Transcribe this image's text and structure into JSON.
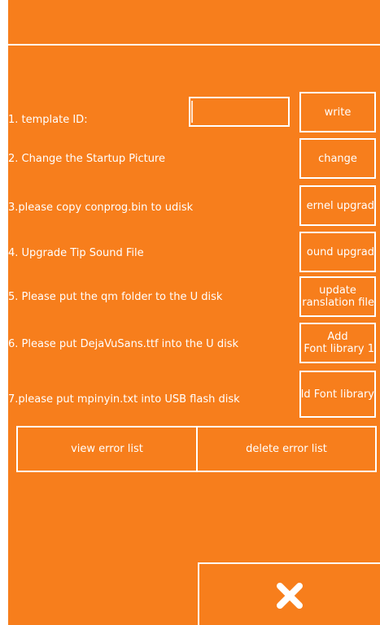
{
  "settings": {
    "items": [
      {
        "label": "1. template ID:",
        "button": [
          "write"
        ]
      },
      {
        "label": "2. Change the Startup Picture",
        "button": [
          "change"
        ]
      },
      {
        "label": "3.please copy conprog.bin to udisk",
        "button": [
          "ernel upgrad"
        ]
      },
      {
        "label": "4. Upgrade Tip Sound File",
        "button": [
          "ound upgrad"
        ]
      },
      {
        "label": "5. Please put the qm folder to the U disk",
        "button": [
          "update",
          "ranslation file"
        ]
      },
      {
        "label": "6. Please put DejaVuSans.ttf into the U disk",
        "button": [
          "Add",
          "Font library 1"
        ]
      },
      {
        "label": "7.please put mpinyin.txt into USB flash disk",
        "button": [
          "ld Font library"
        ]
      }
    ],
    "template_id_value": ""
  },
  "error_buttons": {
    "view": "view error list",
    "delete": "delete error list"
  },
  "close_icon": "close-x-icon",
  "colors": {
    "background": "#f77e1c",
    "foreground": "#ffffff"
  }
}
